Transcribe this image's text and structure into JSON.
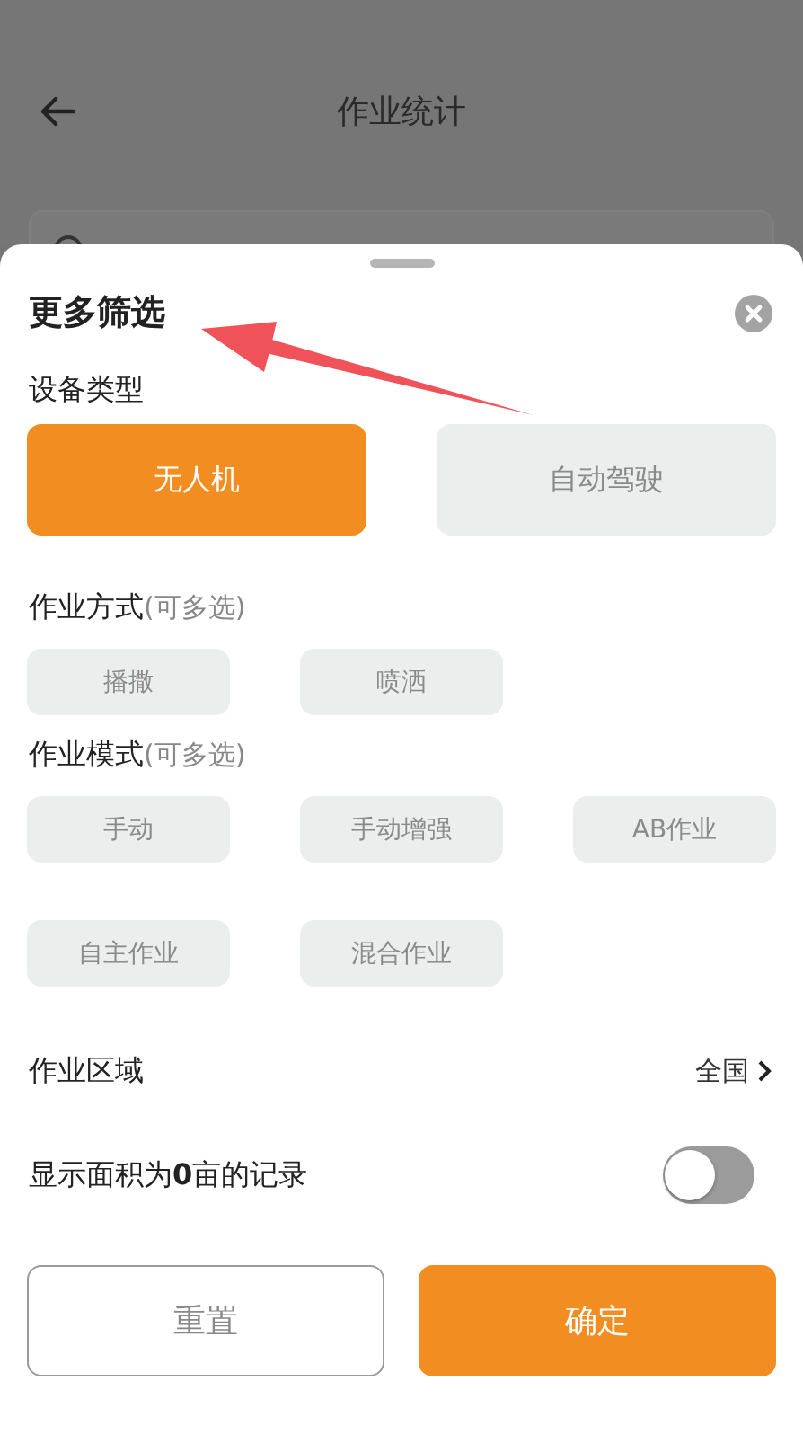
{
  "header": {
    "title": "作业统计"
  },
  "sheet": {
    "title": "更多筛选"
  },
  "sections": [
    {
      "kind": "large",
      "label": "设备类型",
      "options": [
        {
          "label": "无人机",
          "selected": true
        },
        {
          "label": "自动驾驶",
          "selected": false
        }
      ]
    },
    {
      "kind": "small",
      "label": "作业方式",
      "hint": "(可多选)",
      "options": [
        {
          "label": "播撒",
          "selected": false
        },
        {
          "label": "喷洒",
          "selected": false
        }
      ]
    },
    {
      "kind": "small",
      "label": "作业模式",
      "hint": "(可多选)",
      "options": [
        {
          "label": "手动",
          "selected": false
        },
        {
          "label": "手动增强",
          "selected": false
        },
        {
          "label": "AB作业",
          "selected": false
        },
        {
          "label": "自主作业",
          "selected": false
        },
        {
          "label": "混合作业",
          "selected": false
        }
      ]
    }
  ],
  "area": {
    "label": "作业区域",
    "value": "全国"
  },
  "zero_records": {
    "label": "显示面积为**0**亩的记录",
    "on": false
  },
  "buttons": [
    {
      "label": "重置",
      "kind": "secondary"
    },
    {
      "label": "确定",
      "kind": "primary"
    }
  ]
}
